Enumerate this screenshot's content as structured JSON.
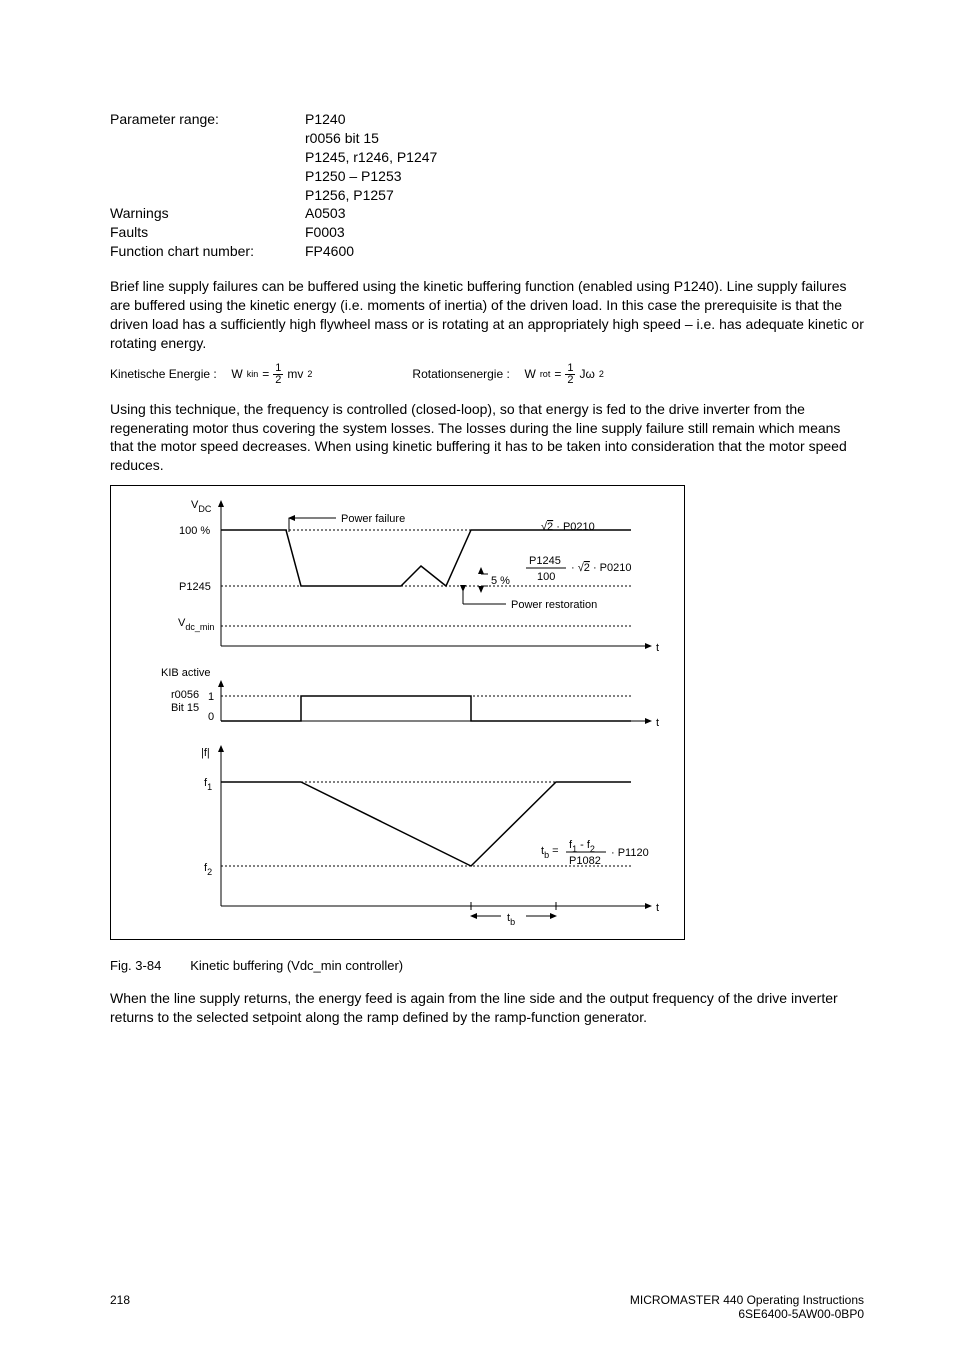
{
  "params": {
    "range_label": "Parameter range:",
    "range_values": [
      "P1240",
      "r0056 bit 15",
      "P1245, r1246, P1247",
      "P1250 – P1253",
      "P1256, P1257"
    ],
    "warnings_label": "Warnings",
    "warnings_value": "A0503",
    "faults_label": "Faults",
    "faults_value": "F0003",
    "fcn_label": "Function chart number:",
    "fcn_value": "FP4600"
  },
  "para1": "Brief line supply failures can be buffered using the kinetic buffering function (enabled using P1240). Line supply failures are buffered using the kinetic energy (i.e. moments of inertia) of the driven load. In this case the prerequisite is that the driven load has a sufficiently high flywheel mass or is rotating at an appropriately high speed – i.e. has adequate kinetic or rotating energy.",
  "formula": {
    "kin_label": "Kinetische Energie :",
    "kin_lhs": "W",
    "kin_sub": "kin",
    "kin_eq": "=",
    "kin_num": "1",
    "kin_den": "2",
    "kin_rhs": "mv",
    "kin_sup": "2",
    "rot_label": "Rotationsenergie :",
    "rot_lhs": "W",
    "rot_sub": "rot",
    "rot_eq": "=",
    "rot_num": "1",
    "rot_den": "2",
    "rot_rhs": "Jω",
    "rot_sup": "2"
  },
  "para2": "Using this technique, the frequency is controlled (closed-loop), so that energy is fed to the drive inverter from the regenerating motor thus covering the system losses. The losses during the line supply failure still remain which means that the motor speed decreases. When using kinetic buffering it has to be taken into consideration that the motor speed reduces.",
  "figure": {
    "vdc": "V",
    "vdc_sub": "DC",
    "hundred": "100 %",
    "p1245": "P1245",
    "vdcmin": "V",
    "vdcmin_sub": "dc_min",
    "power_failure": "Power failure",
    "sqrt2_p0210": "· P0210",
    "sqrt2": "2",
    "five_percent": "5 %",
    "p1245_frac_num": "P1245",
    "p1245_frac_den": "100",
    "p1245_frac_tail": "· P0210",
    "power_restoration": "Power restoration",
    "kib_active": "KIB active",
    "r0056": "r0056",
    "bit15": "Bit 15",
    "one": "1",
    "zero": "0",
    "abs_f": "|f|",
    "f1": "f",
    "f1_sub": "1",
    "f2": "f",
    "f2_sub": "2",
    "t": "t",
    "tb_lhs": "t",
    "tb_lhs_sub": "b",
    "tb_eq": "=",
    "tb_num_lhs": "f",
    "tb_num_lhs_sub": "1",
    "tb_num_mid": " - ",
    "tb_num_rhs": "f",
    "tb_num_rhs_sub": "2",
    "tb_den": "P1082",
    "tb_tail": "· P1120",
    "tb_label": "t",
    "tb_label_sub": "b"
  },
  "fig_caption_prefix": "Fig. 3-84",
  "fig_caption_text": "Kinetic buffering (Vdc_min controller)",
  "para3": "When the line supply returns, the energy feed is again from the line side and the output frequency of the drive inverter returns to the selected setpoint along the ramp defined by the ramp-function generator.",
  "footer": {
    "page": "218",
    "right1": "MICROMASTER 440     Operating Instructions",
    "right2": "6SE6400-5AW00-0BP0"
  }
}
